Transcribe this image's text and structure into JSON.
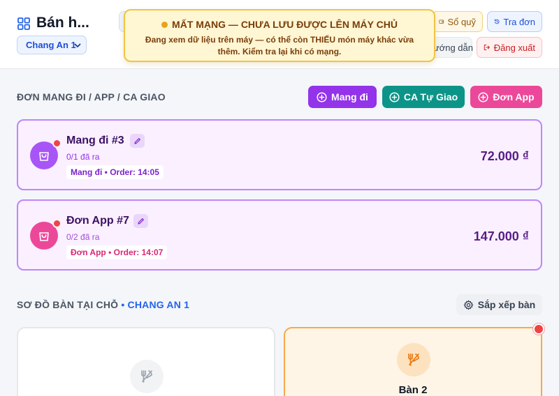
{
  "header": {
    "title": "Bán h...",
    "branch_select": "Chang An 1",
    "buttons": {
      "so_quy": "Sổ quỹ",
      "tra_don": "Tra đơn",
      "huong_dan": "ướng dẫn",
      "dang_xuat": "Đăng xuất"
    }
  },
  "offline_banner": {
    "title": "MẤT MẠNG — CHƯA LƯU ĐƯỢC LÊN MÁY CHỦ",
    "description": "Đang xem dữ liệu trên máy — có thể còn THIẾU món máy khác vừa thêm. Kiểm tra lại khi có mạng."
  },
  "takeaway": {
    "section_title": "ĐƠN MANG ĐI / APP / CA GIAO",
    "actions": {
      "mang_di": "Mang đi",
      "ca_tu_giao": "CA Tự Giao",
      "don_app": "Đơn App"
    },
    "orders": [
      {
        "name": "Mang đi #3",
        "progress": "0/1 đã ra",
        "tag": "Mang đi • Order: 14:05",
        "total": "72.000 ₫"
      },
      {
        "name": "Đơn App #7",
        "progress": "0/2 đã ra",
        "tag": "Đơn App • Order: 14:07",
        "total": "147.000 ₫"
      }
    ]
  },
  "tables": {
    "section_title": "SƠ ĐỒ BÀN TẠI CHỖ",
    "branch": "• CHANG AN 1",
    "arrange_label": "Sắp xếp bàn",
    "items": [
      {
        "name": ""
      },
      {
        "name": "Bàn 2"
      }
    ]
  },
  "colors": {
    "accent_purple": "#9333ea",
    "accent_teal": "#0d9488",
    "accent_pink": "#ec4899",
    "warning_bg": "#fff6d4",
    "danger": "#ef4444"
  },
  "icons": {
    "app": "grid-icon",
    "so_quy": "wallet-icon",
    "tra_don": "history-icon",
    "dang_xuat": "logout-icon",
    "order": "shopping-bag-icon",
    "edit": "pencil-icon",
    "table": "utensils-icon",
    "arrange": "gear-icon"
  }
}
